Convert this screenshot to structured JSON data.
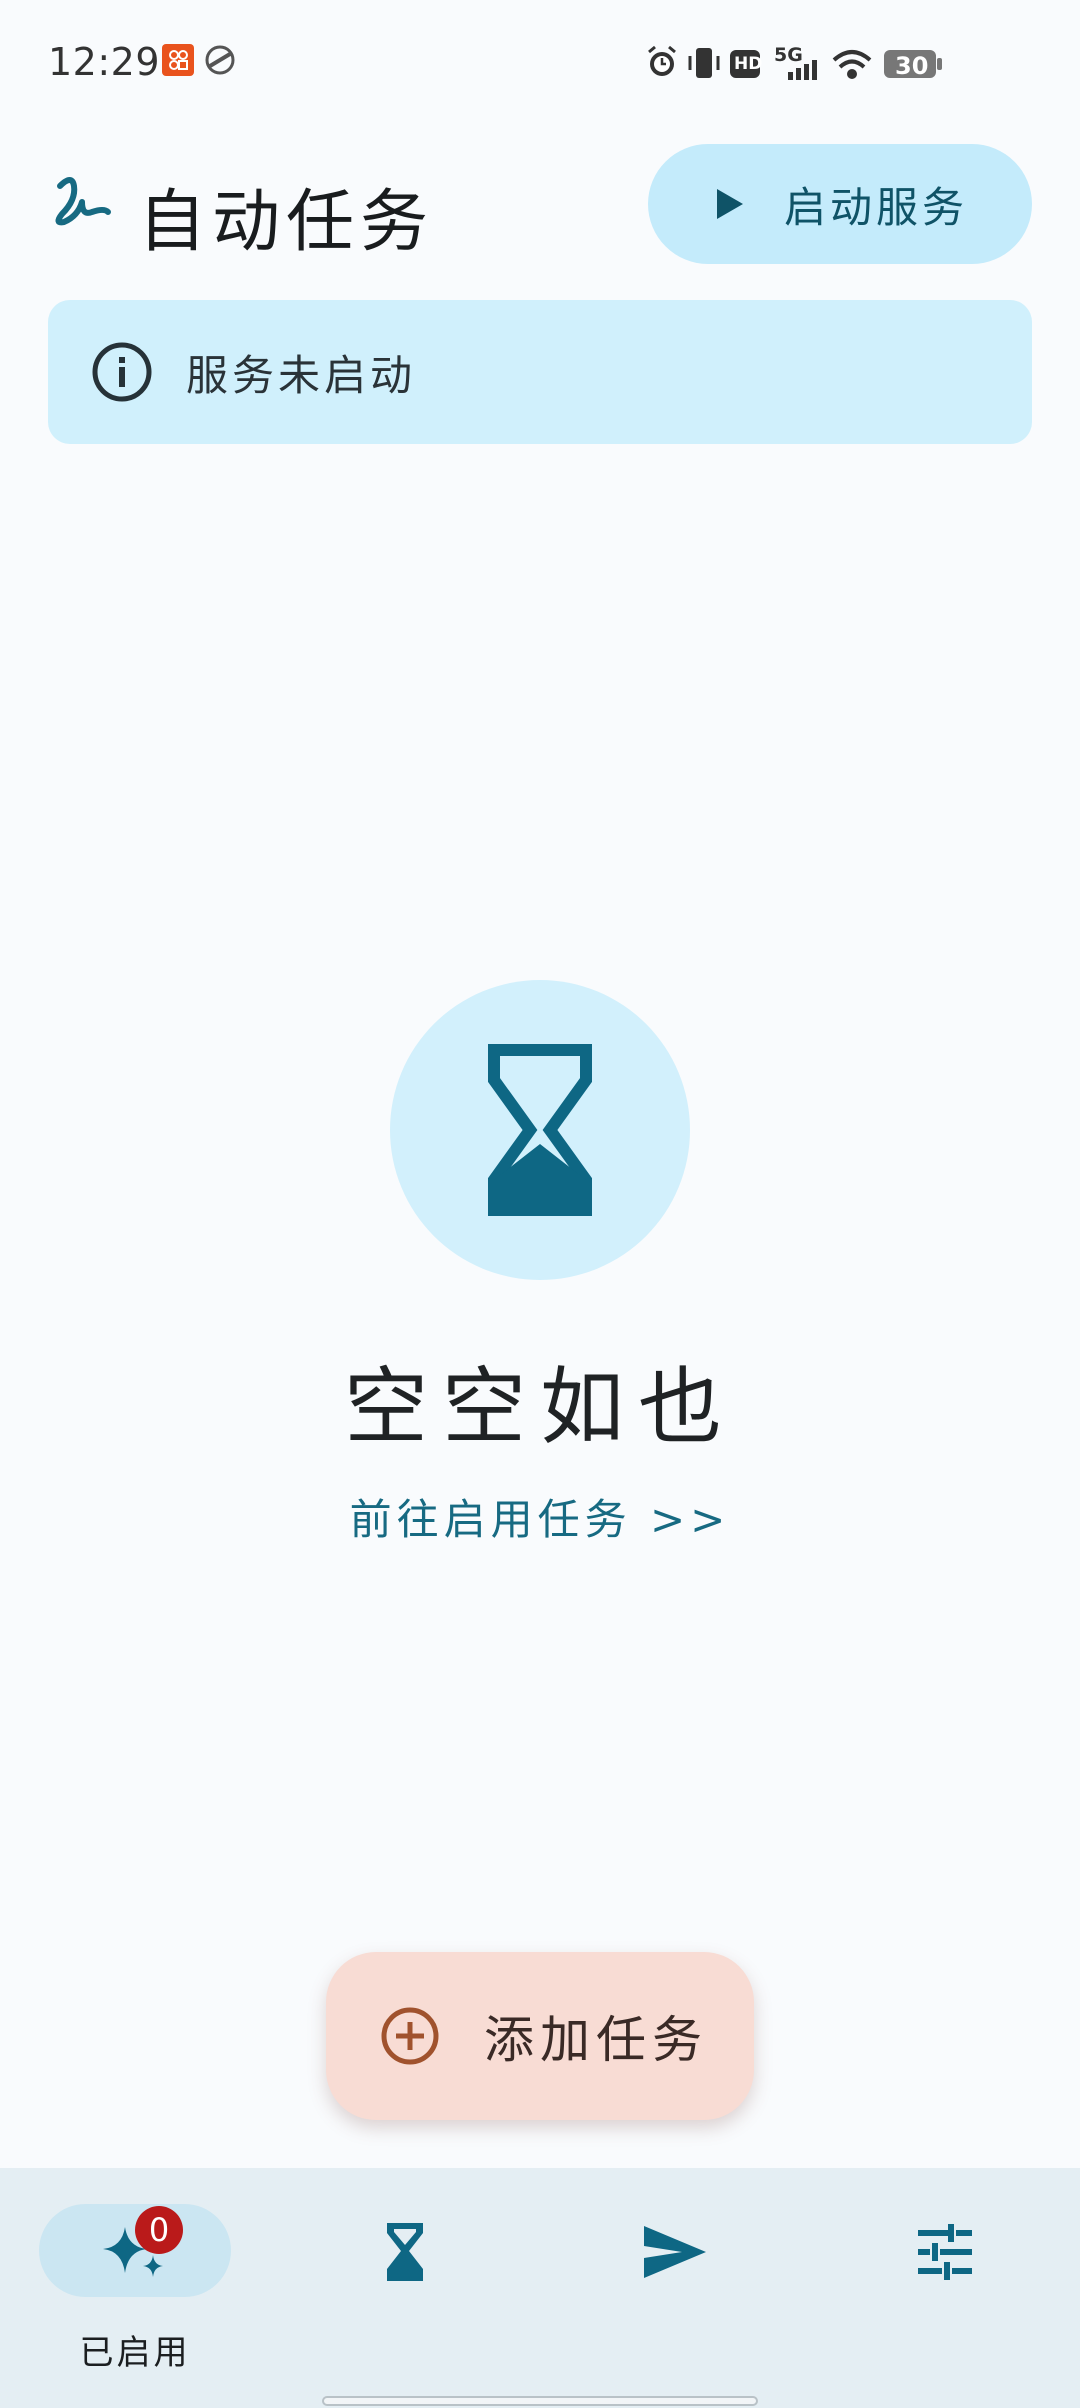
{
  "status_bar": {
    "time": "12:29",
    "battery": "30",
    "network": "5G",
    "hd": "HD",
    "icons": [
      "notification-app-icon",
      "sync-icon",
      "alarm-icon",
      "vibrate-icon",
      "hd-icon",
      "signal-icon",
      "wifi-icon",
      "battery-icon"
    ]
  },
  "header": {
    "title": "自动任务",
    "start_button_label": "启动服务"
  },
  "info_banner": {
    "text": "服务未启动"
  },
  "empty_state": {
    "title": "空空如也",
    "link": "前往启用任务 >>"
  },
  "fab": {
    "label": "添加任务"
  },
  "bottom_nav": {
    "items": [
      {
        "label": "已启用",
        "icon": "sparkle-icon",
        "badge": "0",
        "active": true
      },
      {
        "label": "",
        "icon": "hourglass-icon",
        "active": false
      },
      {
        "label": "",
        "icon": "send-icon",
        "active": false
      },
      {
        "label": "",
        "icon": "tune-icon",
        "active": false
      }
    ]
  },
  "colors": {
    "primary": "#176a82",
    "primary_container": "#c4ebfb",
    "fab_container": "#f8dcd4",
    "fab_icon": "#a0522d",
    "nav_background": "#e4eef3",
    "badge": "#ba1a1a"
  }
}
